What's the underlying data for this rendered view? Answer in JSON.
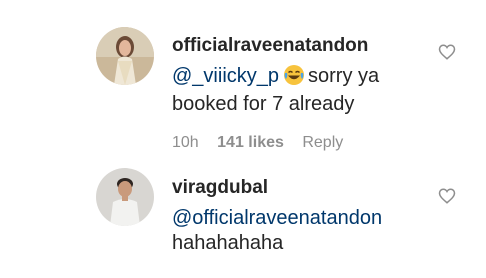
{
  "comments": [
    {
      "username": "officialraveenatandon",
      "mention": "@_viiicky_p",
      "text_after_emoji": "sorry ya",
      "text_line2": "booked for 7 already",
      "emoji": "laughing-tears-emoji",
      "time": "10h",
      "likes": "141 likes",
      "reply_label": "Reply"
    },
    {
      "username": "viragdubal",
      "mention": "@officialraveenatandon",
      "text_line2": "hahahahaha"
    }
  ],
  "colors": {
    "text": "#262626",
    "mention": "#00376b",
    "meta": "#8e8e8e"
  }
}
